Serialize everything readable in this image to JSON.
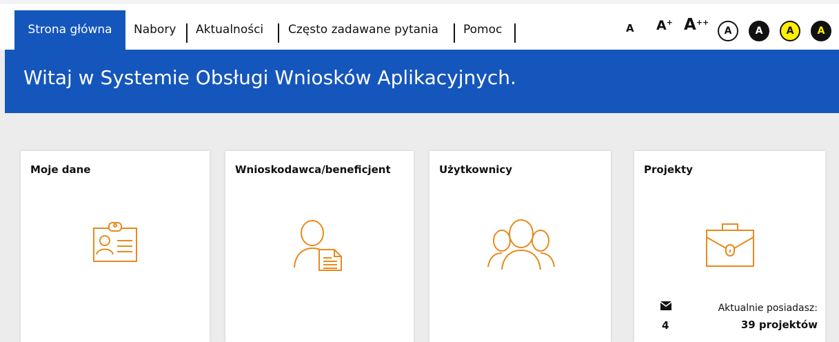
{
  "nav": {
    "active_tab": "Strona główna",
    "links": [
      "Nabory",
      "Aktualności",
      "Często zadawane pytania",
      "Pomoc"
    ]
  },
  "accessibility": {
    "font_small": "A",
    "font_medium": "A",
    "font_medium_sup": "+",
    "font_large": "A",
    "font_large_sup": "++",
    "contrast_labels": [
      "A",
      "A",
      "A",
      "A"
    ]
  },
  "banner": {
    "title": "Witaj w Systemie Obsługi Wniosków Aplikacyjnych."
  },
  "cards": [
    {
      "title": "Moje dane",
      "icon": "id-badge-icon"
    },
    {
      "title": "Wnioskodawca/beneficjent",
      "icon": "person-document-icon"
    },
    {
      "title": "Użytkownicy",
      "icon": "users-group-icon"
    },
    {
      "title": "Projekty",
      "icon": "briefcase-icon"
    }
  ],
  "projects": {
    "messages_count": "4",
    "own_label": "Aktualnie posiadasz:",
    "own_value": "39 projektów"
  },
  "colors": {
    "brand_blue": "#1556bd",
    "icon_orange": "#e8891d",
    "contrast_yellow": "#ffef00"
  }
}
